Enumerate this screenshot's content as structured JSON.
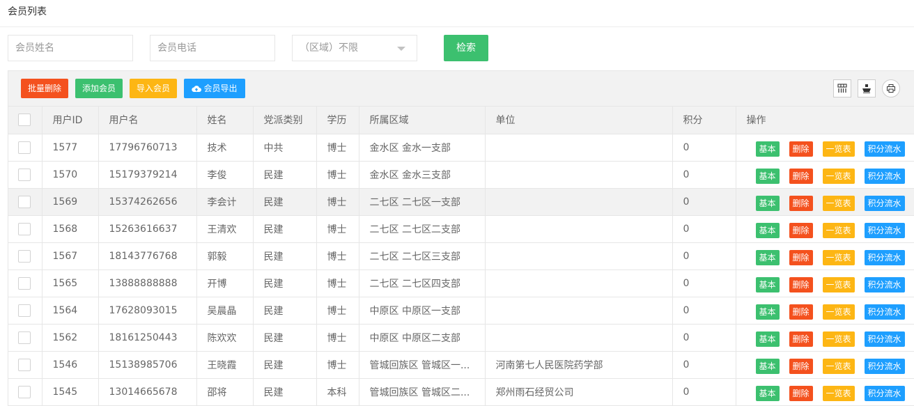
{
  "page": {
    "title": "会员列表"
  },
  "search": {
    "name_placeholder": "会员姓名",
    "phone_placeholder": "会员电话",
    "region_selected": "（区域）不限",
    "search_label": "检索"
  },
  "toolbar": {
    "batch_delete": "批量删除",
    "add_member": "添加会员",
    "import_member": "导入会员",
    "export_member": "会员导出"
  },
  "table": {
    "headers": [
      "用户ID",
      "用户名",
      "姓名",
      "党派类别",
      "学历",
      "所属区域",
      "单位",
      "积分",
      "操作"
    ],
    "actions": {
      "basic": "基本",
      "delete": "删除",
      "list": "一览表",
      "flow": "积分流水"
    },
    "rows": [
      {
        "id": "1577",
        "username": "17796760713",
        "name": "技术",
        "party": "中共",
        "edu": "博士",
        "region": "金水区 金水一支部",
        "unit": "",
        "points": "0"
      },
      {
        "id": "1570",
        "username": "15179379214",
        "name": "李俊",
        "party": "民建",
        "edu": "博士",
        "region": "金水区 金水三支部",
        "unit": "",
        "points": "0"
      },
      {
        "id": "1569",
        "username": "15374262656",
        "name": "李会计",
        "party": "民建",
        "edu": "博士",
        "region": "二七区 二七区一支部",
        "unit": "",
        "points": "0"
      },
      {
        "id": "1568",
        "username": "15263616637",
        "name": "王清欢",
        "party": "民建",
        "edu": "博士",
        "region": "二七区 二七区二支部",
        "unit": "",
        "points": "0"
      },
      {
        "id": "1567",
        "username": "18143776768",
        "name": "郭毅",
        "party": "民建",
        "edu": "博士",
        "region": "二七区 二七区三支部",
        "unit": "",
        "points": "0"
      },
      {
        "id": "1565",
        "username": "13888888888",
        "name": "开博",
        "party": "民建",
        "edu": "博士",
        "region": "二七区 二七区四支部",
        "unit": "",
        "points": "0"
      },
      {
        "id": "1564",
        "username": "17628093015",
        "name": "吴晨晶",
        "party": "民建",
        "edu": "博士",
        "region": "中原区 中原区一支部",
        "unit": "",
        "points": "0"
      },
      {
        "id": "1562",
        "username": "18161250443",
        "name": "陈欢欢",
        "party": "民建",
        "edu": "博士",
        "region": "中原区 中原区二支部",
        "unit": "",
        "points": "0"
      },
      {
        "id": "1546",
        "username": "15138985706",
        "name": "王晓霞",
        "party": "民建",
        "edu": "博士",
        "region": "管城回族区 管城区一...",
        "unit": "河南第七人民医院药学部",
        "points": "0"
      },
      {
        "id": "1545",
        "username": "13014665678",
        "name": "邵将",
        "party": "民建",
        "edu": "本科",
        "region": "管城回族区 管城区二...",
        "unit": "郑州雨石经贸公司",
        "points": "0"
      }
    ]
  }
}
